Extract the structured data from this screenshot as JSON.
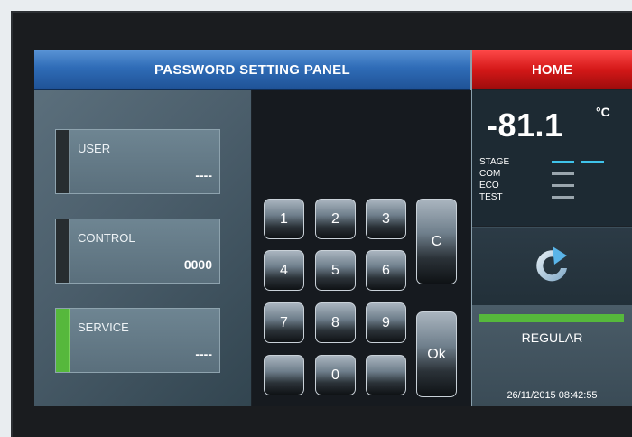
{
  "header": {
    "title": "PASSWORD SETTING PANEL",
    "home": "HOME"
  },
  "fields": [
    {
      "label": "USER",
      "value": "----"
    },
    {
      "label": "CONTROL",
      "value": "0000"
    },
    {
      "label": "SERVICE",
      "value": "----"
    }
  ],
  "keypad": {
    "k1": "1",
    "k2": "2",
    "k3": "3",
    "k4": "4",
    "k5": "5",
    "k6": "6",
    "k7": "7",
    "k8": "8",
    "k9": "9",
    "k0": "0",
    "clear": "C",
    "ok": "Ok"
  },
  "status": {
    "temperature": "-81.1",
    "unit": "°C",
    "labels": [
      "STAGE",
      "COM",
      "ECO",
      "TEST"
    ],
    "mode": "REGULAR",
    "datetime": "26/11/2015 08:42:55",
    "refresh_icon": "refresh-icon"
  },
  "colors": {
    "title_blue": "#2f6cb7",
    "home_red": "#d41818",
    "active_green": "#56b83c",
    "indicator_cyan": "#3fc3ea"
  }
}
